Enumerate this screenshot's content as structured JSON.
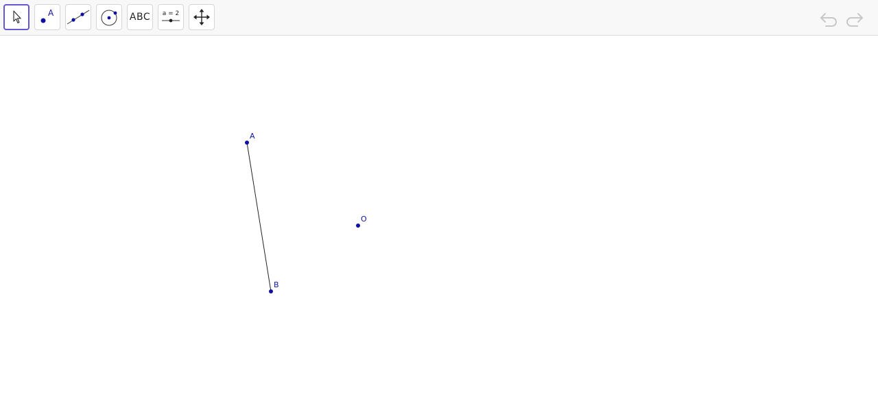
{
  "toolbar": {
    "tools": [
      {
        "name": "Move",
        "icon": "arrow-pointer-icon",
        "selected": true
      },
      {
        "name": "Point",
        "icon": "point-icon",
        "glyph": "A"
      },
      {
        "name": "Segment",
        "icon": "segment-icon"
      },
      {
        "name": "Circle with Center through Point",
        "icon": "circle-icon"
      },
      {
        "name": "Text",
        "icon": "text-icon",
        "glyph": "ABC"
      },
      {
        "name": "Slider",
        "icon": "slider-icon",
        "glyph": "a = 2"
      },
      {
        "name": "Move Graphics View",
        "icon": "move-view-icon"
      }
    ],
    "undo": {
      "icon": "undo-icon",
      "enabled": false
    },
    "redo": {
      "icon": "redo-icon",
      "enabled": false
    }
  },
  "graphics": {
    "point_color": "#1010a0",
    "segment_color": "#222222",
    "points": [
      {
        "label": "A"
      },
      {
        "label": "B"
      },
      {
        "label": "O"
      }
    ],
    "segments": [
      {
        "from": "A",
        "to": "B"
      }
    ]
  }
}
